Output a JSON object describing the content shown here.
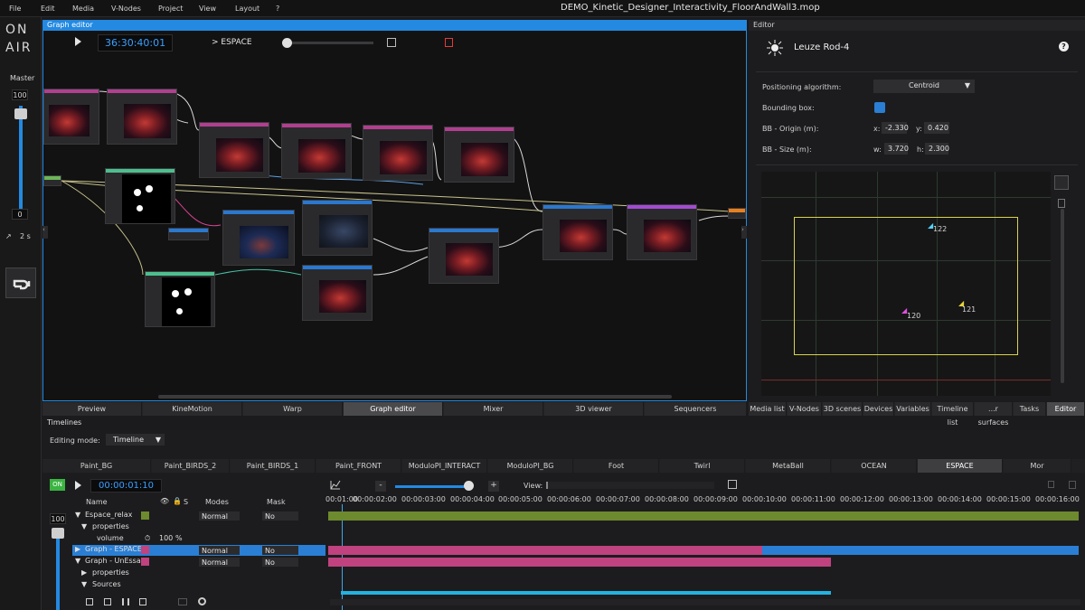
{
  "menu": [
    "File",
    "Edit",
    "Media",
    "V-Nodes",
    "Project",
    "View",
    "Layout",
    "?"
  ],
  "title": "DEMO_Kinetic_Designer_Interactivity_FloorAndWall3.mop",
  "left": {
    "logo_top": "ON",
    "logo_bottom": "AIR",
    "master_label": "Master",
    "master_value": "100",
    "counter": "0",
    "fade": "2 s"
  },
  "graph_editor": {
    "header": "Graph editor",
    "timecode": "36:30:40:01",
    "graph_name": "> ESPACE"
  },
  "bottom_tabs": [
    "Preview",
    "KineMotion",
    "Warp",
    "Graph editor",
    "Mixer",
    "3D viewer",
    "Sequencers"
  ],
  "editor": {
    "header": "Editor",
    "device_name": "Leuze Rod-4",
    "help_icon": "?",
    "positioning_label": "Positioning algorithm:",
    "positioning_value": "Centroid",
    "bbox_label": "Bounding box:",
    "origin_label": "BB - Origin (m):",
    "origin_x_label": "x:",
    "origin_x": "-2.330",
    "origin_y_label": "y:",
    "origin_y": "0.420",
    "size_label": "BB - Size (m):",
    "size_w_label": "w:",
    "size_w": "3.720",
    "size_h_label": "h:",
    "size_h": "2.300",
    "points": [
      "122",
      "121",
      "120"
    ]
  },
  "editor_tabs": [
    "Media list",
    "V-Nodes",
    "3D scenes",
    "Devices",
    "Variables",
    "Timeline list",
    "...r surfaces",
    "Tasks",
    "Editor"
  ],
  "timelines": {
    "title": "Timelines",
    "editing_mode_label": "Editing mode:",
    "editing_mode_value": "Timeline",
    "tabs": [
      "Paint_BG",
      "Paint_BIRDS_2",
      "Paint_BIRDS_1",
      "Paint_FRONT",
      "ModuloPI_INTERACT",
      "ModuloPI_BG",
      "Foot",
      "Twirl",
      "MetaBall",
      "OCEAN",
      "ESPACE",
      "Mor"
    ],
    "on_label": "ON",
    "timecode": "00:00:01:10",
    "view_label": "View:",
    "columns": {
      "name": "Name",
      "solo": "S",
      "modes": "Modes",
      "mask": "Mask"
    },
    "master": "100",
    "ruler": [
      "00:01:00",
      "00:00:02:00",
      "00:00:03:00",
      "00:00:04:00",
      "00:00:05:00",
      "00:00:06:00",
      "00:00:07:00",
      "00:00:08:00",
      "00:00:09:00",
      "00:00:10:00",
      "00:00:11:00",
      "00:00:12:00",
      "00:00:13:00",
      "00:00:14:00",
      "00:00:15:00",
      "00:00:16:00"
    ],
    "rows": [
      {
        "name": "Espace_relax",
        "mode": "Normal",
        "mask": "No"
      },
      {
        "name": "properties"
      },
      {
        "name": "volume",
        "value": "100",
        "unit": "%"
      },
      {
        "name": "Graph - ESPACE",
        "mode": "Normal",
        "mask": "No"
      },
      {
        "name": "Graph - UnEssaiEsp",
        "mode": "Normal",
        "mask": "No"
      },
      {
        "name": "properties"
      },
      {
        "name": "Sources"
      }
    ]
  },
  "colors": {
    "accent": "#2389e1",
    "green_track": "#6e8a2e",
    "pink_track": "#c0427f",
    "blue_track": "#2a7fd4",
    "cyan_track": "#22b3e0",
    "bbox": "#d8d34a"
  }
}
